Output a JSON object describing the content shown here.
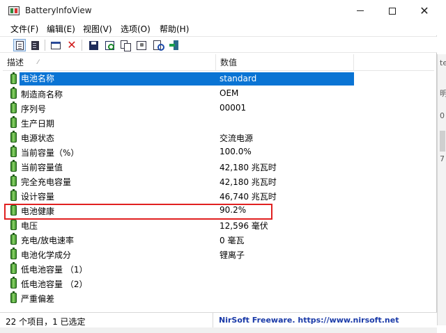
{
  "window": {
    "title": "BatteryInfoView"
  },
  "menu": [
    "文件(F)",
    "编辑(E)",
    "视图(V)",
    "选项(O)",
    "帮助(H)"
  ],
  "toolbar_icons": [
    "html-report-icon",
    "text-report-icon",
    "window-icon",
    "delete-icon",
    "save-icon",
    "refresh-icon",
    "copy-icon",
    "properties-icon",
    "find-icon",
    "exit-icon"
  ],
  "columns": [
    "描述",
    "数值"
  ],
  "rows": [
    {
      "name": "电池名称",
      "value": "standard"
    },
    {
      "name": "制造商名称",
      "value": "OEM"
    },
    {
      "name": "序列号",
      "value": "00001"
    },
    {
      "name": "生产日期",
      "value": ""
    },
    {
      "name": "电源状态",
      "value": "交流电源"
    },
    {
      "name": "当前容量（%）",
      "value": "100.0%"
    },
    {
      "name": "当前容量值",
      "value": "42,180 兆瓦时"
    },
    {
      "name": "完全充电容量",
      "value": "42,180 兆瓦时"
    },
    {
      "name": "设计容量",
      "value": "46,740 兆瓦时"
    },
    {
      "name": "电池健康",
      "value": "90.2%"
    },
    {
      "name": "电压",
      "value": "12,596 毫伏"
    },
    {
      "name": "充电/放电速率",
      "value": "0 毫瓦"
    },
    {
      "name": "电池化学成分",
      "value": "锂离子"
    },
    {
      "name": "低电池容量 （1）",
      "value": ""
    },
    {
      "name": "低电池容量 （2）",
      "value": ""
    },
    {
      "name": "严重偏差",
      "value": ""
    }
  ],
  "selected_row": 0,
  "highlighted_row": 9,
  "status": {
    "items": "22 个项目，1 已选定",
    "credit": "NirSoft Freeware. https://www.nirsoft.net"
  },
  "peek": {
    "t1": "te",
    "t2": "明",
    "t3": "0",
    "t4": "7"
  },
  "colors": {
    "selection": "#0a74d4",
    "highlight_border": "#e02020",
    "link": "#1a3aa8"
  }
}
